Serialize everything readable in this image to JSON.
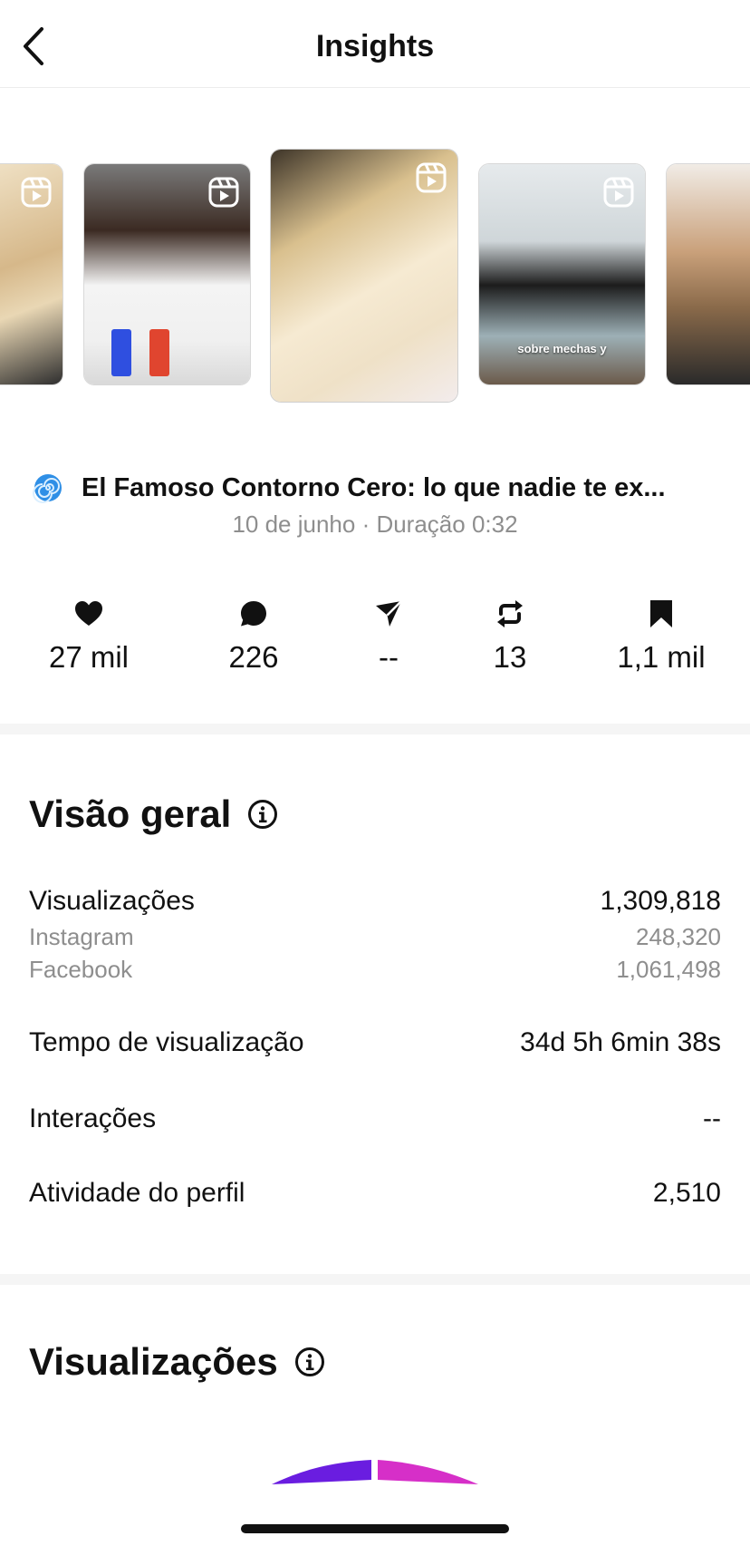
{
  "header": {
    "title": "Insights"
  },
  "carousel": {
    "items": [
      {
        "name": "reel-thumb-1",
        "colors": [
          "#e9d7b4",
          "#c8a67a",
          "#3a3a3a"
        ]
      },
      {
        "name": "reel-thumb-2",
        "colors": [
          "#f2f2f2",
          "#2b1a14",
          "#e04a3c"
        ]
      },
      {
        "name": "reel-thumb-3",
        "colors": [
          "#d8c090",
          "#f5e8d2",
          "#4a3a2a"
        ]
      },
      {
        "name": "reel-thumb-4",
        "colors": [
          "#dfe5e8",
          "#1a1a1a",
          "#8aa0a8"
        ],
        "caption": "sobre mechas y"
      },
      {
        "name": "reel-thumb-5",
        "colors": [
          "#eee6dd",
          "#8a6a4a",
          "#2a2a2a"
        ]
      }
    ]
  },
  "post": {
    "emoji_icon": "spiral-icon",
    "title": "El Famoso Contorno Cero: lo que nadie te ex...",
    "subtitle": "10 de junho · Duração 0:32"
  },
  "stats": {
    "likes": "27 mil",
    "comments": "226",
    "shares": "--",
    "reposts": "13",
    "saves": "1,1 mil"
  },
  "overview": {
    "title": "Visão geral",
    "views_label": "Visualizações",
    "views_value": "1,309,818",
    "instagram_label": "Instagram",
    "instagram_value": "248,320",
    "facebook_label": "Facebook",
    "facebook_value": "1,061,498",
    "watch_time_label": "Tempo de visualização",
    "watch_time_value": "34d 5h 6min 38s",
    "interactions_label": "Interações",
    "interactions_value": "--",
    "profile_activity_label": "Atividade do perfil",
    "profile_activity_value": "2,510"
  },
  "views_section": {
    "title": "Visualizações",
    "donut_colors": {
      "instagram": "#6a1de0",
      "facebook": "#d62fc8"
    },
    "shares": {
      "instagram": 248320,
      "facebook": 1061498
    }
  }
}
